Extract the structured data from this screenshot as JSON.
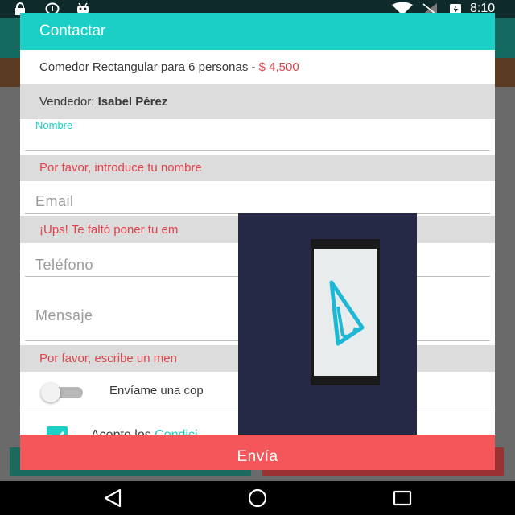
{
  "status_bar": {
    "time": "8:10",
    "icons": [
      "lock-icon",
      "info-icon",
      "android-icon",
      "wifi-icon",
      "no-signal-icon",
      "battery-charging-icon"
    ]
  },
  "dialog": {
    "title": "Contactar",
    "product": {
      "name": "Comedor Rectangular para 6 personas - ",
      "price": "$ 4,500"
    },
    "seller": {
      "label": "Vendedor: ",
      "name": "Isabel Pérez"
    },
    "fields": {
      "name": {
        "label": "Nombre",
        "value": ""
      },
      "email": {
        "placeholder": "Email",
        "value": ""
      },
      "phone": {
        "placeholder": "Teléfono",
        "value": ""
      },
      "message": {
        "placeholder": "Mensaje",
        "value": ""
      }
    },
    "errors": {
      "name": "Por favor, introduce tu nombre",
      "email": "¡Ups! Te faltó poner tu em",
      "message": "Por favor, escribe un men"
    },
    "copy_switch": {
      "label": "Envíame una cop",
      "on": false
    },
    "accept": {
      "prefix": "Acepto los ",
      "link": "Condici",
      "checked": true
    },
    "submit_label": "Envía"
  },
  "colors": {
    "accent": "#1ccfc6",
    "error": "#e0434b",
    "submit": "#f4565a"
  }
}
